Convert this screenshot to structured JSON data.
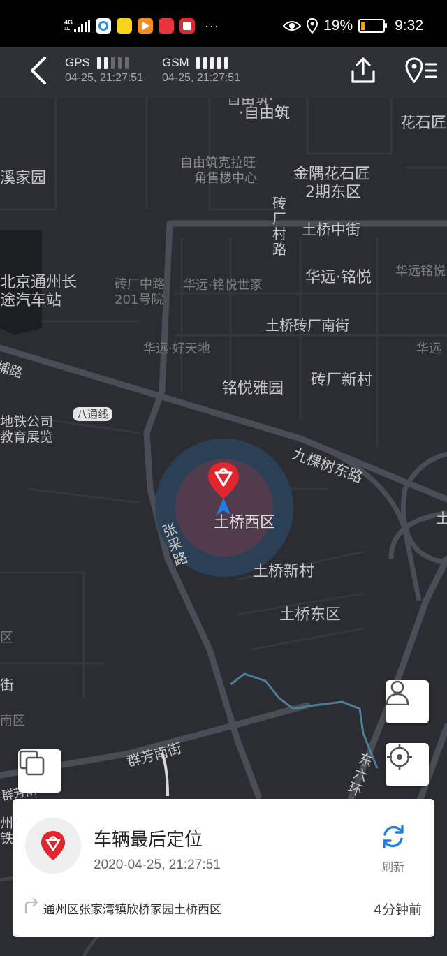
{
  "status_bar": {
    "network": "4G",
    "network_sub": "1L",
    "more": "···",
    "battery": "19%",
    "battery_level": 0.19,
    "time": "9:32"
  },
  "header": {
    "gps": {
      "label": "GPS",
      "time": "04-25, 21:27:51",
      "strength": 2
    },
    "gsm": {
      "label": "GSM",
      "time": "04-25, 21:27:51",
      "strength": 5
    }
  },
  "map": {
    "labels": {
      "ziyouzhu": "·自由筑",
      "ziyouzhu_top": "自由筑·",
      "huashi_edge": "花石匠",
      "xijiayuan": "溪家园",
      "corner_shop": "自由筑克拉旺角售楼中心",
      "corner_shop_l1": "自由筑克拉旺",
      "corner_shop_l2": "角售楼中心",
      "jinyu_l1": "金隅花石匠",
      "jinyu_l2": "2期东区",
      "zhuanchang_road": "砖厂村路",
      "tuqiao_middle": "土桥中街",
      "huayuan_mingyue": "华远·铭悦",
      "huayuan_mingyue_edge": "华远铭悦",
      "bus_l1": "北京通州长",
      "bus_l2": "途汽车站",
      "zhuanchang_201_l1": "砖厂中路",
      "zhuanchang_201_l2": "201号院",
      "mingyue_shijia": "华远·铭悦世家",
      "zhuanchang_south": "土桥砖厂南街",
      "haotiandi": "华远·好天地",
      "huayuan_edge": "华远",
      "road_pu": "埔路",
      "mingyue_yayuan": "铭悦雅园",
      "zhuanchang_xincun": "砖厂新村",
      "batong_line": "八通线",
      "subway_l1": "地铁公司",
      "subway_l2": "教育展览",
      "jiukeshu_road": "九棵树东路",
      "tuqiao_west": "土桥西区",
      "zhangcai_road": "张采路",
      "tuqiao_xincun": "土桥新村",
      "tuqiao_east": "土桥东区",
      "edge_qu": "区",
      "edge_jie": "街",
      "edge_nanqu": "南区",
      "qunfang_south": "群芳南街",
      "dongliuhuan": "东六环",
      "edge_zhou": "州",
      "edge_tie": "铁",
      "edge_tu": "土",
      "edge_jiu": "群芳南"
    }
  },
  "card": {
    "title": "车辆最后定位",
    "datetime": "2020-04-25, 21:27:51",
    "refresh_label": "刷新",
    "address": "通州区张家湾镇欣桥家园土桥西区",
    "ago": "4分钟前"
  },
  "colors": {
    "brand_red": "#e0262f",
    "accent_blue": "#1f7fe6",
    "map_bg": "#2b2d33",
    "road": "#4a4d56"
  }
}
